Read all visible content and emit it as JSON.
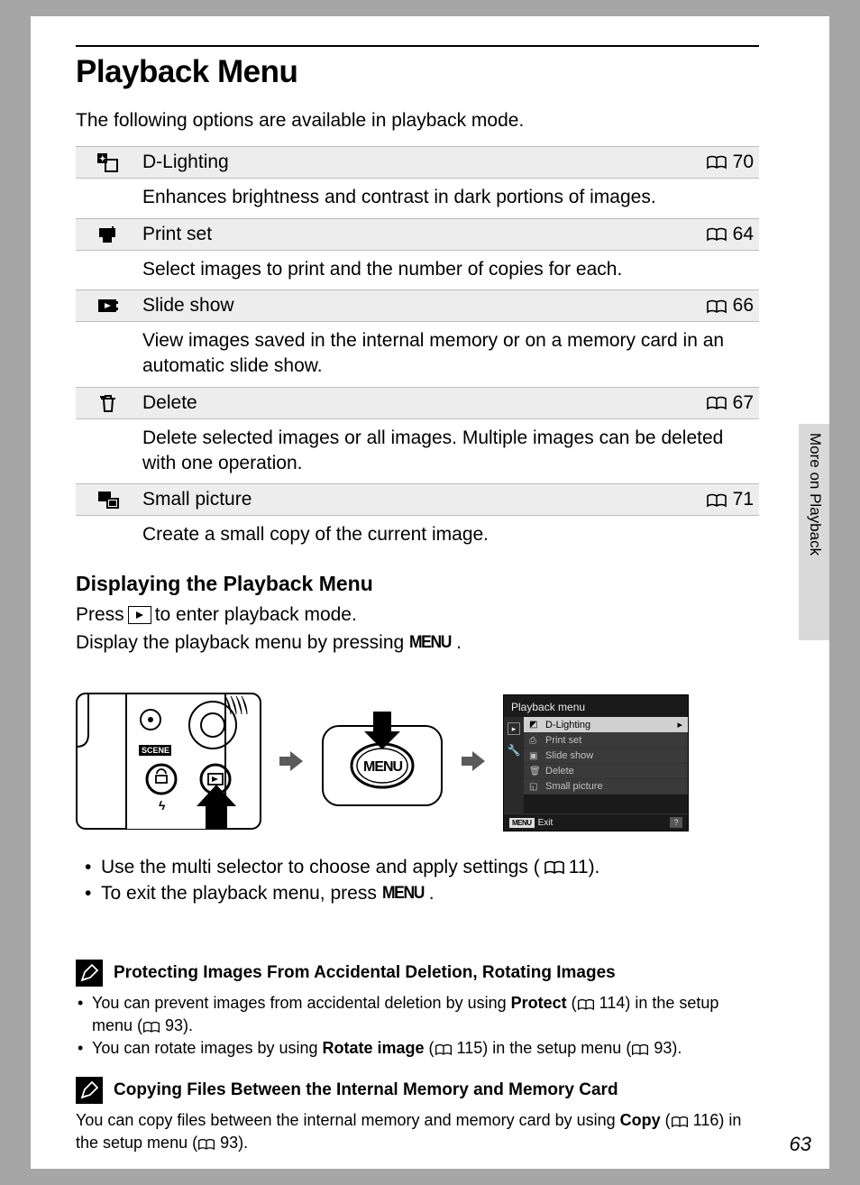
{
  "title": "Playback Menu",
  "intro": "The following options are available in playback mode.",
  "options": [
    {
      "name": "D-Lighting",
      "page": "70",
      "desc": "Enhances brightness and contrast in dark portions of images."
    },
    {
      "name": "Print set",
      "page": "64",
      "desc": "Select images to print and the number of copies for each."
    },
    {
      "name": "Slide show",
      "page": "66",
      "desc": "View images saved in the internal memory or on a memory card in an automatic slide show."
    },
    {
      "name": "Delete",
      "page": "67",
      "desc": "Delete selected images or all images. Multiple images can be deleted with one operation."
    },
    {
      "name": "Small picture",
      "page": "71",
      "desc": "Create a small copy of the current image."
    }
  ],
  "sub_heading": "Displaying the Playback Menu",
  "line1_a": "Press",
  "line1_b": "to enter playback mode.",
  "line2_a": "Display the playback menu by pressing",
  "line2_b": ".",
  "menu_word": "MENU",
  "bullet1_a": "Use the multi selector to choose and apply settings (",
  "bullet1_b": "11).",
  "bullet2_a": "To exit the playback menu, press",
  "bullet2_b": ".",
  "lcd": {
    "title": "Playback menu",
    "items": [
      "D-Lighting",
      "Print set",
      "Slide show",
      "Delete",
      "Small picture"
    ],
    "exit": "Exit",
    "menu_btn": "MENU"
  },
  "note1": {
    "title": "Protecting Images From Accidental Deletion, Rotating Images",
    "li1_html": "You can prevent images from accidental deletion by using <b>Protect</b> (__BOOK__ 114) in the setup menu (__BOOK__ 93).",
    "li2_html": "You can rotate images by using <b>Rotate image</b> (__BOOK__ 115) in the setup menu (__BOOK__ 93)."
  },
  "note2": {
    "title": "Copying Files Between the Internal Memory and Memory Card",
    "para_html": "You can copy files between the internal memory and memory card by using <b>Copy</b> (__BOOK__ 116) in the setup menu (__BOOK__ 93)."
  },
  "side_label": "More on Playback",
  "page_num": "63"
}
